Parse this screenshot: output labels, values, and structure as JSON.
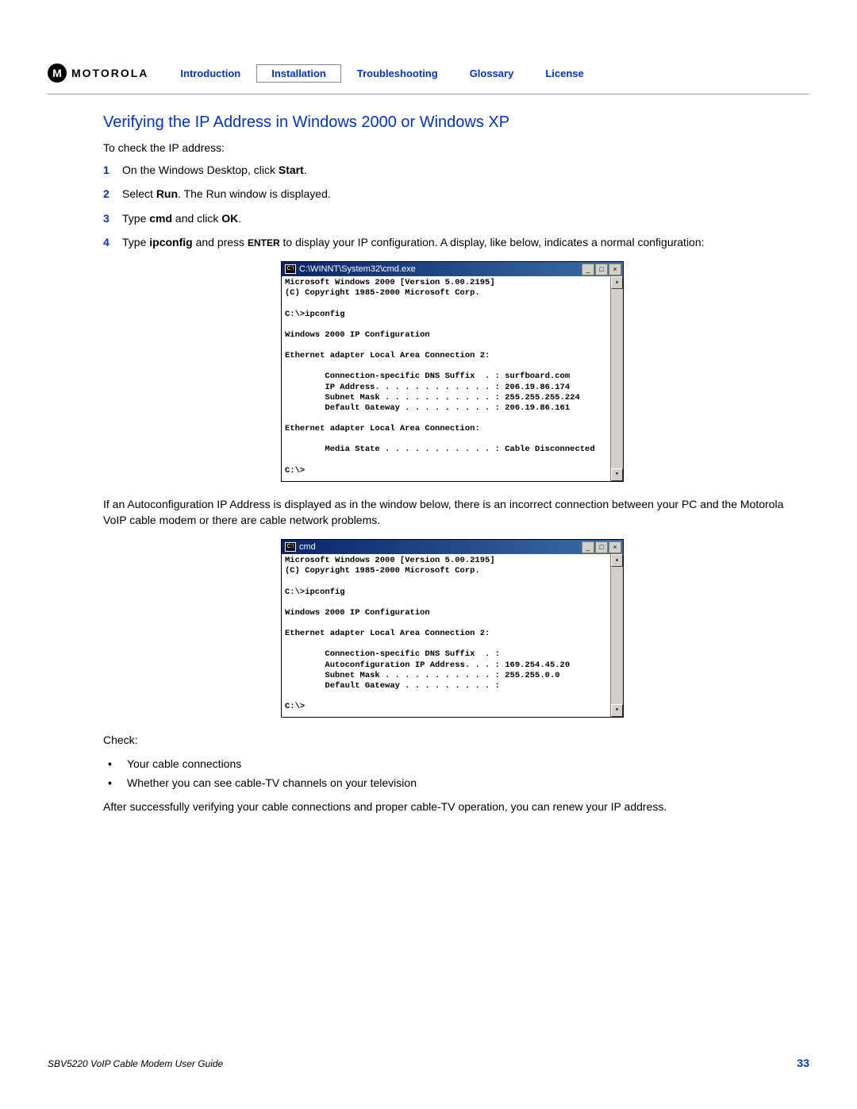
{
  "header": {
    "logo_glyph": "M",
    "logo_text": "MOTOROLA",
    "nav": {
      "introduction": "Introduction",
      "installation": "Installation",
      "troubleshooting": "Troubleshooting",
      "glossary": "Glossary",
      "license": "License"
    }
  },
  "title": "Verifying the IP Address in Windows 2000 or Windows XP",
  "intro": "To check the IP address:",
  "steps": {
    "s1": {
      "num": "1",
      "pre": "On the Windows Desktop, click ",
      "bold": "Start",
      "post": "."
    },
    "s2": {
      "num": "2",
      "pre": "Select ",
      "bold": "Run",
      "post": ". The Run window is displayed."
    },
    "s3": {
      "num": "3",
      "pre": "Type ",
      "bold1": "cmd",
      "mid": " and click ",
      "bold2": "OK",
      "post": "."
    },
    "s4": {
      "num": "4",
      "pre": "Type ",
      "bold": "ipconfig",
      "mid1": " and press ",
      "enter": "ENTER",
      "mid2": " to display your IP configuration. A display, like below, indicates a normal configuration:"
    }
  },
  "cmd1": {
    "title": "C:\\WINNT\\System32\\cmd.exe",
    "body": "Microsoft Windows 2000 [Version 5.00.2195]\n(C) Copyright 1985-2000 Microsoft Corp.\n\nC:\\>ipconfig\n\nWindows 2000 IP Configuration\n\nEthernet adapter Local Area Connection 2:\n\n        Connection-specific DNS Suffix  . : surfboard.com\n        IP Address. . . . . . . . . . . . : 206.19.86.174\n        Subnet Mask . . . . . . . . . . . : 255.255.255.224\n        Default Gateway . . . . . . . . . : 206.19.86.161\n\nEthernet adapter Local Area Connection:\n\n        Media State . . . . . . . . . . . : Cable Disconnected\n\nC:\\>"
  },
  "mid_para": "If an Autoconfiguration IP Address is displayed as in the window below, there is an incorrect connection between your PC and the Motorola VoIP cable modem or there are cable network problems.",
  "cmd2": {
    "title": "cmd",
    "body": "Microsoft Windows 2000 [Version 5.00.2195]\n(C) Copyright 1985-2000 Microsoft Corp.\n\nC:\\>ipconfig\n\nWindows 2000 IP Configuration\n\nEthernet adapter Local Area Connection 2:\n\n        Connection-specific DNS Suffix  . :\n        Autoconfiguration IP Address. . . : 169.254.45.20\n        Subnet Mask . . . . . . . . . . . : 255.255.0.0\n        Default Gateway . . . . . . . . . :\n\nC:\\>"
  },
  "check_label": "Check:",
  "bullets": {
    "b1": "Your cable connections",
    "b2": "Whether you can see cable-TV channels on your television"
  },
  "closing": "After successfully verifying your cable connections and proper cable-TV operation, you can renew your IP address.",
  "footer": {
    "left": "SBV5220 VoIP Cable Modem User Guide",
    "right": "33"
  },
  "winbtns": {
    "min": "_",
    "max": "□",
    "close": "×"
  },
  "scroll": {
    "up": "▴",
    "down": "▾"
  }
}
